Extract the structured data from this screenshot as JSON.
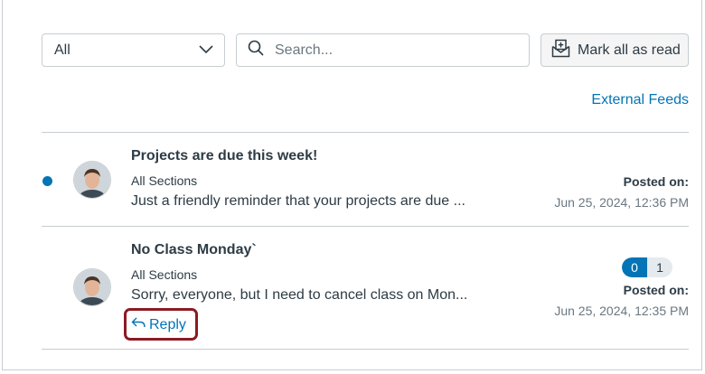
{
  "toolbar": {
    "filter_value": "All",
    "search_placeholder": "Search...",
    "mark_all_label": "Mark all as read",
    "external_feeds_label": "External Feeds"
  },
  "announcements": [
    {
      "title": "Projects are due this week!",
      "section": "All Sections",
      "snippet": "Just a friendly reminder that your projects are due ...",
      "posted_label": "Posted on:",
      "posted_date": "Jun 25, 2024, 12:36 PM",
      "unread": true
    },
    {
      "title": "No Class Monday`",
      "section": "All Sections",
      "snippet": "Sorry, everyone, but I need to cancel class on Mon...",
      "posted_label": "Posted on:",
      "posted_date": "Jun 25, 2024, 12:35 PM",
      "unread_replies": "0",
      "total_replies": "1",
      "reply_label": "Reply"
    }
  ],
  "colors": {
    "link": "#0374b5",
    "highlight": "#8b1a24",
    "text": "#2d3b45",
    "muted": "#6b7780"
  }
}
